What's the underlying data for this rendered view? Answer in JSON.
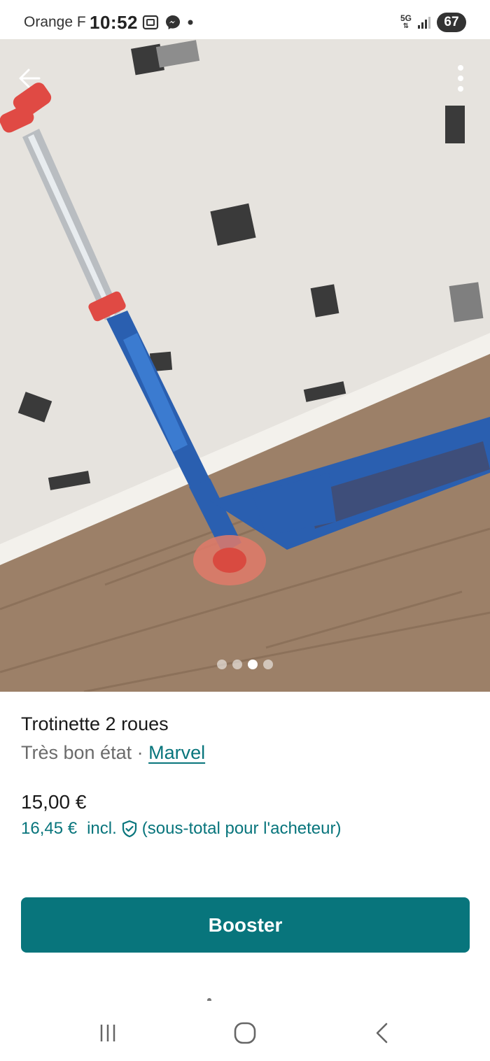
{
  "status_bar": {
    "carrier": "Orange F",
    "time": "10:52",
    "network": "5G",
    "battery": "67"
  },
  "photo": {
    "pager": {
      "count": 4,
      "active_index": 2
    },
    "icons": {
      "back": "arrow-left-icon",
      "more": "more-vertical-icon"
    }
  },
  "item": {
    "title": "Trotinette 2 roues",
    "condition": "Très bon état",
    "separator": " · ",
    "brand": "Marvel",
    "price": "15,00 €",
    "price_incl": "16,45 €",
    "incl_label": "incl.",
    "incl_note": "(sous-total pour l'acheteur)"
  },
  "actions": {
    "booster_label": "Booster"
  },
  "colors": {
    "accent": "#08757c",
    "text": "#1a1a1a",
    "muted": "#6b6b6b"
  },
  "nav_bar": {
    "icons": [
      "recent-apps-icon",
      "home-icon",
      "back-icon"
    ]
  }
}
